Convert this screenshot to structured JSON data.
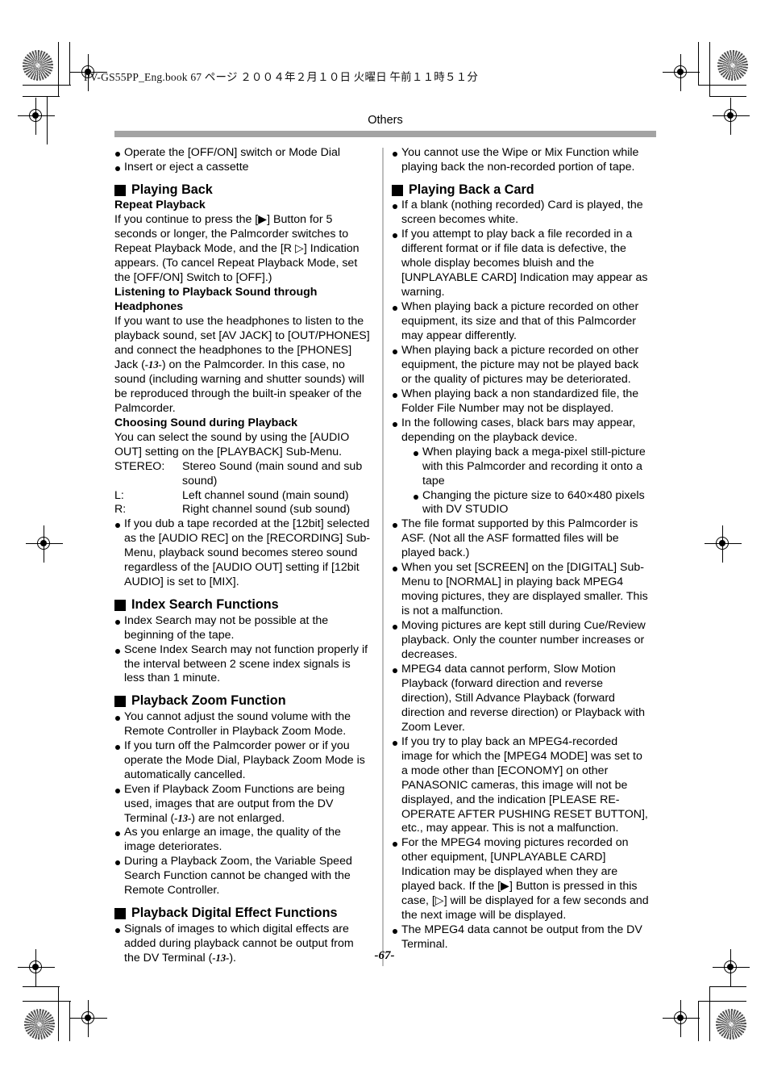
{
  "print": {
    "filestamp": "PV-GS55PP_Eng.book   67 ページ   ２００４年２月１０日   火曜日   午前１１時５１分"
  },
  "page": {
    "running_head": "Others",
    "folio": "-67-"
  },
  "left_column": {
    "intro_bullets": [
      "Operate the [OFF/ON] switch or Mode Dial",
      "Insert or eject a cassette"
    ],
    "section_playing_back": {
      "heading": "Playing Back",
      "sub1": "Repeat Playback",
      "para1": "If you continue to press the [▶] Button for 5 seconds or longer, the Palmcorder switches to Repeat Playback Mode, and the [R ▷] Indication appears. (To cancel Repeat Playback Mode, set the [OFF/ON] Switch to [OFF].)",
      "sub2": "Listening to Playback Sound through Headphones",
      "para2_a": "If you want to use the headphones to listen to the playback sound, set [AV JACK] to [OUT/PHONES] and connect the headphones to the [PHONES] Jack (",
      "para2_ref": "-13-",
      "para2_b": ") on the Palmcorder. In this case, no sound (including warning and shutter sounds) will be reproduced through the built-in speaker of the Palmcorder.",
      "sub3": "Choosing Sound during Playback",
      "para3": "You can select the sound by using the [AUDIO OUT] setting on the [PLAYBACK] Sub-Menu.",
      "audio_modes": [
        {
          "key": "STEREO:",
          "value": "Stereo Sound (main sound and sub sound)"
        },
        {
          "key": "L:",
          "value": "Left channel sound (main sound)"
        },
        {
          "key": "R:",
          "value": "Right channel sound (sub sound)"
        }
      ],
      "bullets": [
        "If you dub a tape recorded at the [12bit] selected as the [AUDIO REC] on the [RECORDING] Sub-Menu, playback sound becomes stereo sound regardless of the [AUDIO OUT] setting if [12bit AUDIO] is set to [MIX]."
      ]
    },
    "section_index_search": {
      "heading": "Index Search Functions",
      "bullets": [
        "Index Search may not be possible at the beginning of the tape.",
        "Scene Index Search may not function properly if the interval between 2 scene index signals is less than 1 minute."
      ]
    },
    "section_playback_zoom": {
      "heading": "Playback Zoom Function",
      "bullets": [
        "You cannot adjust the sound volume with the Remote Controller in Playback Zoom Mode.",
        "If you turn off the Palmcorder power or if you operate the Mode Dial, Playback Zoom Mode is automatically cancelled.",
        "As you enlarge an image, the quality of the image deteriorates.",
        "During a Playback Zoom, the Variable Speed Search Function cannot be changed with the Remote Controller."
      ],
      "bullet_with_ref_a": "Even if Playback Zoom Functions are being used, images that are output from the DV Terminal (",
      "bullet_with_ref": "-13-",
      "bullet_with_ref_b": ") are not enlarged."
    },
    "section_playback_digital_effect": {
      "heading": "Playback Digital Effect Functions",
      "bullet_a": "Signals of images to which digital effects are added during playback cannot be output from the DV Terminal (",
      "bullet_ref": "-13-",
      "bullet_b": ")."
    }
  },
  "right_column": {
    "top_bullets": [
      "You cannot use the Wipe or Mix Function while playing back the non-recorded portion of tape."
    ],
    "section_playing_back_card": {
      "heading": "Playing Back a Card",
      "bullets": [
        "If a blank (nothing recorded) Card is played, the screen becomes white.",
        "If you attempt to play back a file recorded in a different format or if file data is defective, the whole display becomes bluish and the [UNPLAYABLE CARD] Indication may appear as warning.",
        "When playing back a picture recorded on other equipment, its size and that of this Palmcorder may appear differently.",
        "When playing back a picture recorded on other equipment, the picture may not be played back or the quality of pictures may be deteriorated.",
        "When playing back a non standardized file, the Folder File Number may not be displayed."
      ],
      "black_bars_intro": "In the following cases, black bars may appear, depending on the playback device.",
      "black_bars_sub": [
        "When playing back a mega-pixel still-picture with this Palmcorder and recording it onto a tape",
        "Changing the picture size to 640×480 pixels with DV STUDIO"
      ],
      "bullets_after": [
        "The file format supported by this Palmcorder is ASF. (Not all the ASF formatted files will be played back.)",
        "When you set [SCREEN] on the [DIGITAL] Sub-Menu to [NORMAL] in playing back MPEG4 moving pictures, they are displayed smaller. This is not a malfunction.",
        "Moving pictures are kept still during Cue/Review playback. Only the counter number increases or decreases.",
        "MPEG4 data cannot perform, Slow Motion Playback (forward direction and reverse direction), Still Advance Playback (forward direction and reverse direction) or Playback with Zoom Lever.",
        "If you try to play back an MPEG4-recorded image for which the [MPEG4 MODE] was set to a mode other than [ECONOMY] on other PANASONIC cameras, this image will not be displayed, and the indication [PLEASE RE-OPERATE AFTER PUSHING RESET BUTTON], etc., may appear. This is not a malfunction."
      ],
      "mpeg4_unplayable": "For the MPEG4 moving pictures recorded on other equipment, [UNPLAYABLE CARD] Indication may be displayed when they are played back. If the [▶] Button is pressed in this case, [▷] will be displayed for a few seconds and the next image will be displayed.",
      "last_bullet": "The MPEG4 data cannot be output from the DV Terminal."
    }
  }
}
